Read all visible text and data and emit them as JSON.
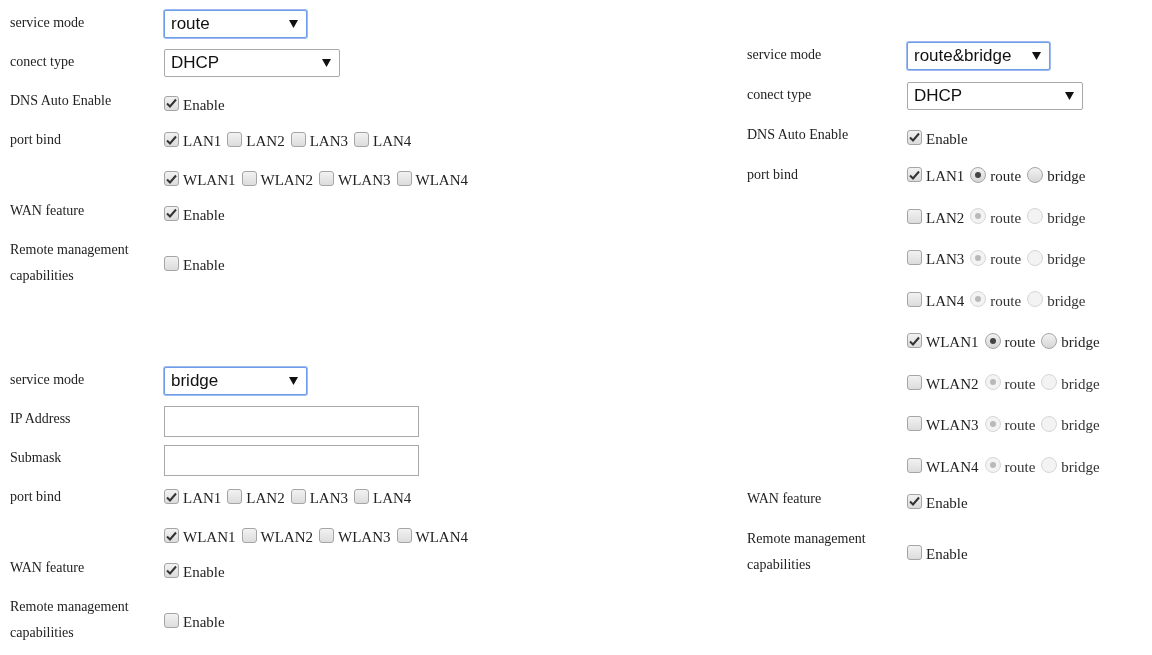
{
  "panels": [
    {
      "rows": [
        {
          "kind": "select",
          "label": "service mode",
          "value": "route",
          "focused": true,
          "wide": false
        },
        {
          "kind": "select",
          "label": "conect type",
          "value": "DHCP",
          "focused": false,
          "wide": true
        },
        {
          "kind": "checkbox",
          "label": "DNS Auto Enable",
          "option": "Enable",
          "checked": true
        },
        {
          "kind": "ports",
          "label": "port bind",
          "lines": [
            {
              "items": [
                {
                  "label": "LAN1",
                  "checked": true
                },
                {
                  "label": "LAN2",
                  "checked": false
                },
                {
                  "label": "LAN3",
                  "checked": false
                },
                {
                  "label": "LAN4",
                  "checked": false
                }
              ]
            },
            {
              "items": [
                {
                  "label": "WLAN1",
                  "checked": true
                },
                {
                  "label": "WLAN2",
                  "checked": false
                },
                {
                  "label": "WLAN3",
                  "checked": false
                },
                {
                  "label": "WLAN4",
                  "checked": false
                }
              ]
            }
          ]
        },
        {
          "kind": "checkbox",
          "label": "WAN feature",
          "option": "Enable",
          "checked": true
        },
        {
          "kind": "checkbox",
          "label": "Remote management capabilities",
          "option": "Enable",
          "checked": false
        }
      ]
    },
    {
      "rows": [
        {
          "kind": "select",
          "label": "service mode",
          "value": "bridge",
          "focused": true,
          "wide": false
        },
        {
          "kind": "text",
          "label": "IP Address"
        },
        {
          "kind": "text",
          "label": "Submask"
        },
        {
          "kind": "ports",
          "label": "port bind",
          "lines": [
            {
              "items": [
                {
                  "label": "LAN1",
                  "checked": true
                },
                {
                  "label": "LAN2",
                  "checked": false
                },
                {
                  "label": "LAN3",
                  "checked": false
                },
                {
                  "label": "LAN4",
                  "checked": false
                }
              ]
            },
            {
              "items": [
                {
                  "label": "WLAN1",
                  "checked": true
                },
                {
                  "label": "WLAN2",
                  "checked": false
                },
                {
                  "label": "WLAN3",
                  "checked": false
                },
                {
                  "label": "WLAN4",
                  "checked": false
                }
              ]
            }
          ]
        },
        {
          "kind": "checkbox",
          "label": "WAN feature",
          "option": "Enable",
          "checked": true
        },
        {
          "kind": "checkbox",
          "label": "Remote management capabilities",
          "option": "Enable",
          "checked": false
        }
      ]
    },
    {
      "rows": [
        {
          "kind": "select",
          "label": "service mode",
          "value": "route&bridge",
          "focused": true,
          "wide": false
        },
        {
          "kind": "select",
          "label": "conect type",
          "value": "DHCP",
          "focused": false,
          "wide": true
        },
        {
          "kind": "checkbox",
          "label": "DNS Auto Enable",
          "option": "Enable",
          "checked": true
        },
        {
          "kind": "port-modes",
          "label": "port bind",
          "ports": [
            {
              "label": "LAN1",
              "checked": true,
              "disabled": false,
              "modes": [
                {
                  "label": "route",
                  "selected": true
                },
                {
                  "label": "bridge",
                  "selected": false
                }
              ]
            },
            {
              "label": "LAN2",
              "checked": false,
              "disabled": true,
              "modes": [
                {
                  "label": "route",
                  "selected": true
                },
                {
                  "label": "bridge",
                  "selected": false
                }
              ]
            },
            {
              "label": "LAN3",
              "checked": false,
              "disabled": true,
              "modes": [
                {
                  "label": "route",
                  "selected": true
                },
                {
                  "label": "bridge",
                  "selected": false
                }
              ]
            },
            {
              "label": "LAN4",
              "checked": false,
              "disabled": true,
              "modes": [
                {
                  "label": "route",
                  "selected": true
                },
                {
                  "label": "bridge",
                  "selected": false
                }
              ]
            },
            {
              "label": "WLAN1",
              "checked": true,
              "disabled": false,
              "modes": [
                {
                  "label": "route",
                  "selected": true
                },
                {
                  "label": "bridge",
                  "selected": false
                }
              ]
            },
            {
              "label": "WLAN2",
              "checked": false,
              "disabled": true,
              "modes": [
                {
                  "label": "route",
                  "selected": true
                },
                {
                  "label": "bridge",
                  "selected": false
                }
              ]
            },
            {
              "label": "WLAN3",
              "checked": false,
              "disabled": true,
              "modes": [
                {
                  "label": "route",
                  "selected": true
                },
                {
                  "label": "bridge",
                  "selected": false
                }
              ]
            },
            {
              "label": "WLAN4",
              "checked": false,
              "disabled": true,
              "modes": [
                {
                  "label": "route",
                  "selected": true
                },
                {
                  "label": "bridge",
                  "selected": false
                }
              ]
            }
          ]
        },
        {
          "kind": "checkbox",
          "label": "WAN feature",
          "option": "Enable",
          "checked": true
        },
        {
          "kind": "checkbox",
          "label": "Remote management capabilities",
          "option": "Enable",
          "checked": false
        }
      ]
    }
  ]
}
